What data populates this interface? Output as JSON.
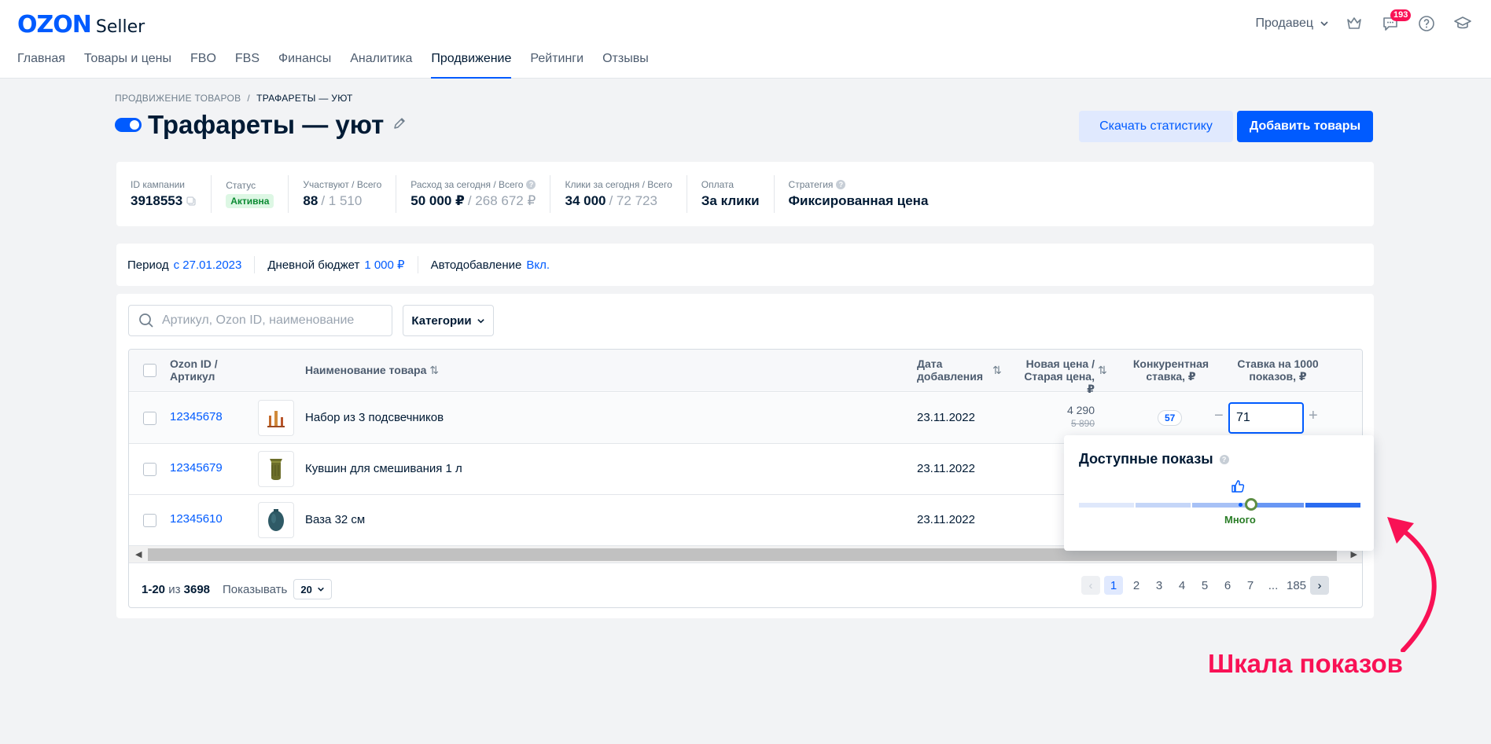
{
  "header": {
    "logo_brand": "OZON",
    "logo_product": "Seller",
    "seller_label": "Продавец",
    "notifications_count": "193"
  },
  "nav": {
    "items": [
      "Главная",
      "Товары и цены",
      "FBO",
      "FBS",
      "Финансы",
      "Аналитика",
      "Продвижение",
      "Рейтинги",
      "Отзывы"
    ],
    "active": "Продвижение"
  },
  "breadcrumb": {
    "root": "ПРОДВИЖЕНИЕ ТОВАРОВ",
    "sep": "/",
    "current": "ТРАФАРЕТЫ — УЮТ"
  },
  "page": {
    "title": "Трафареты — уют",
    "toggle_on": true,
    "download_label": "Скачать статистику",
    "add_label": "Добавить товары"
  },
  "stats": {
    "campaign_id_label": "ID кампании",
    "campaign_id": "3918553",
    "status_label": "Статус",
    "status": "Активна",
    "participants_label": "Участвуют / Всего",
    "participants": "88",
    "participants_total": "/ 1 510",
    "spend_label": "Расход за сегодня / Всего",
    "spend": "50 000 ₽",
    "spend_total": "/ 268 672 ₽",
    "clicks_label": "Клики за сегодня / Всего",
    "clicks": "34 000",
    "clicks_total": "/ 72 723",
    "payment_label": "Оплата",
    "payment": "За клики",
    "strategy_label": "Стратегия",
    "strategy": "Фиксированная цена"
  },
  "period": {
    "period_label": "Период",
    "period_value": "с 27.01.2023",
    "budget_label": "Дневной бюджет",
    "budget_value": "1 000 ₽",
    "auto_label": "Автодобавление",
    "auto_value": "Вкл."
  },
  "filters": {
    "search_placeholder": "Артикул, Ozon ID, наименование",
    "categories_label": "Категории"
  },
  "table": {
    "headers": {
      "ozon_id_1": "Ozon ID /",
      "ozon_id_2": "Артикул",
      "name": "Наименование товара",
      "date_1": "Дата",
      "date_2": "добавления",
      "price_1": "Новая цена /",
      "price_2": "Старая цена, ₽",
      "comp_1": "Конкурентная",
      "comp_2": "ставка, ₽",
      "bid_1": "Ставка на 1000",
      "bid_2": "показов, ₽"
    },
    "rows": [
      {
        "id": "12345678",
        "name": "Набор из 3 подсвечников",
        "date": "23.11.2022",
        "price_new": "4 290",
        "price_old": "5 890",
        "competitive": "57",
        "bid": "71"
      },
      {
        "id": "12345679",
        "name": "Кувшин для смешивания 1 л",
        "date": "23.11.2022"
      },
      {
        "id": "12345610",
        "name": "Ваза 32 см",
        "date": "23.11.2022"
      }
    ]
  },
  "footer": {
    "range": "1-20",
    "of": "из",
    "total": "3698",
    "show_label": "Показывать",
    "per_page": "20",
    "pages": [
      "1",
      "2",
      "3",
      "4",
      "5",
      "6",
      "7",
      "...",
      "185"
    ],
    "active_page": "1"
  },
  "popover": {
    "title": "Доступные показы",
    "level_label": "Много",
    "level_fraction": 0.62
  },
  "annotation": {
    "text": "Шкала показов",
    "color": "#f91155"
  },
  "colors": {
    "accent": "#005bff",
    "status_green": "#0c8b33"
  }
}
